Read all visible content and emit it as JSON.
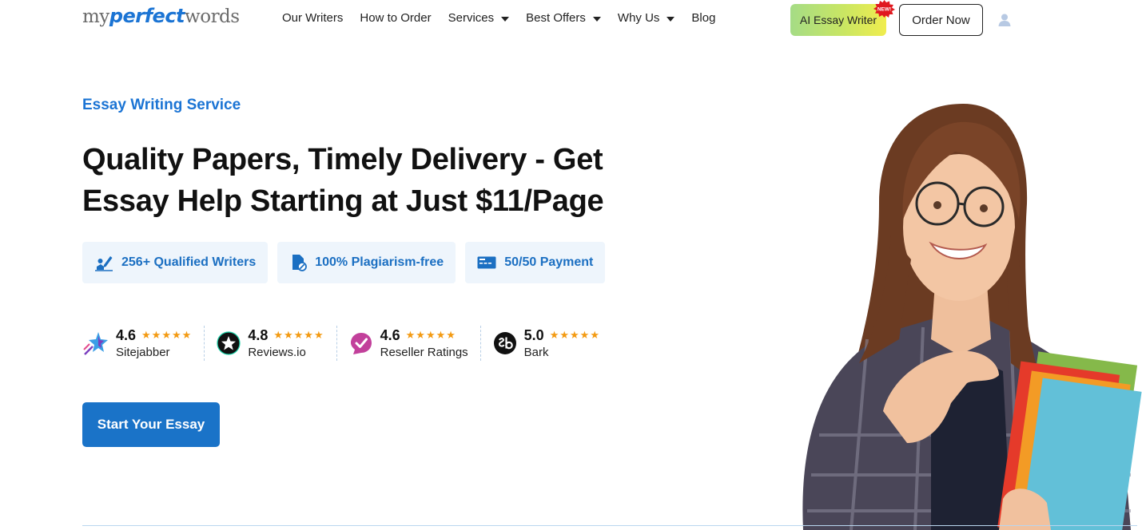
{
  "header": {
    "logo": {
      "part1": "my",
      "part2": "perfect",
      "part3": "words"
    },
    "nav": [
      {
        "label": "Our Writers",
        "has_dropdown": false
      },
      {
        "label": "How to Order",
        "has_dropdown": false
      },
      {
        "label": "Services",
        "has_dropdown": true
      },
      {
        "label": "Best Offers",
        "has_dropdown": true
      },
      {
        "label": "Why Us",
        "has_dropdown": true
      },
      {
        "label": "Blog",
        "has_dropdown": false
      }
    ],
    "ai_button": "AI Essay Writer",
    "new_badge": "NEW!",
    "order_button": "Order Now",
    "user_icon": "user-icon"
  },
  "hero": {
    "eyebrow": "Essay Writing Service",
    "headline": "Quality Papers, Timely Delivery - Get Essay Help Starting at Just $11/Page",
    "features": [
      {
        "icon": "writer-pen-icon",
        "label": "256+ Qualified Writers"
      },
      {
        "icon": "document-check-icon",
        "label": "100% Plagiarism-free"
      },
      {
        "icon": "credit-card-icon",
        "label": "50/50 Payment"
      }
    ],
    "ratings": [
      {
        "icon": "sitejabber-icon",
        "score": "4.6",
        "stars": "★★★★★",
        "name": "Sitejabber"
      },
      {
        "icon": "reviewsio-icon",
        "score": "4.8",
        "stars": "★★★★★",
        "name": "Reviews.io"
      },
      {
        "icon": "resellerratings-icon",
        "score": "4.6",
        "stars": "★★★★★",
        "name": "Reseller Ratings"
      },
      {
        "icon": "bark-icon",
        "score": "5.0",
        "stars": "★★★★★",
        "name": "Bark"
      }
    ],
    "cta": "Start Your Essay"
  },
  "colors": {
    "brand_blue": "#1b74d4",
    "cta_blue": "#1a73c8",
    "star_orange": "#f39a12",
    "feature_bg": "#eef5fc"
  }
}
